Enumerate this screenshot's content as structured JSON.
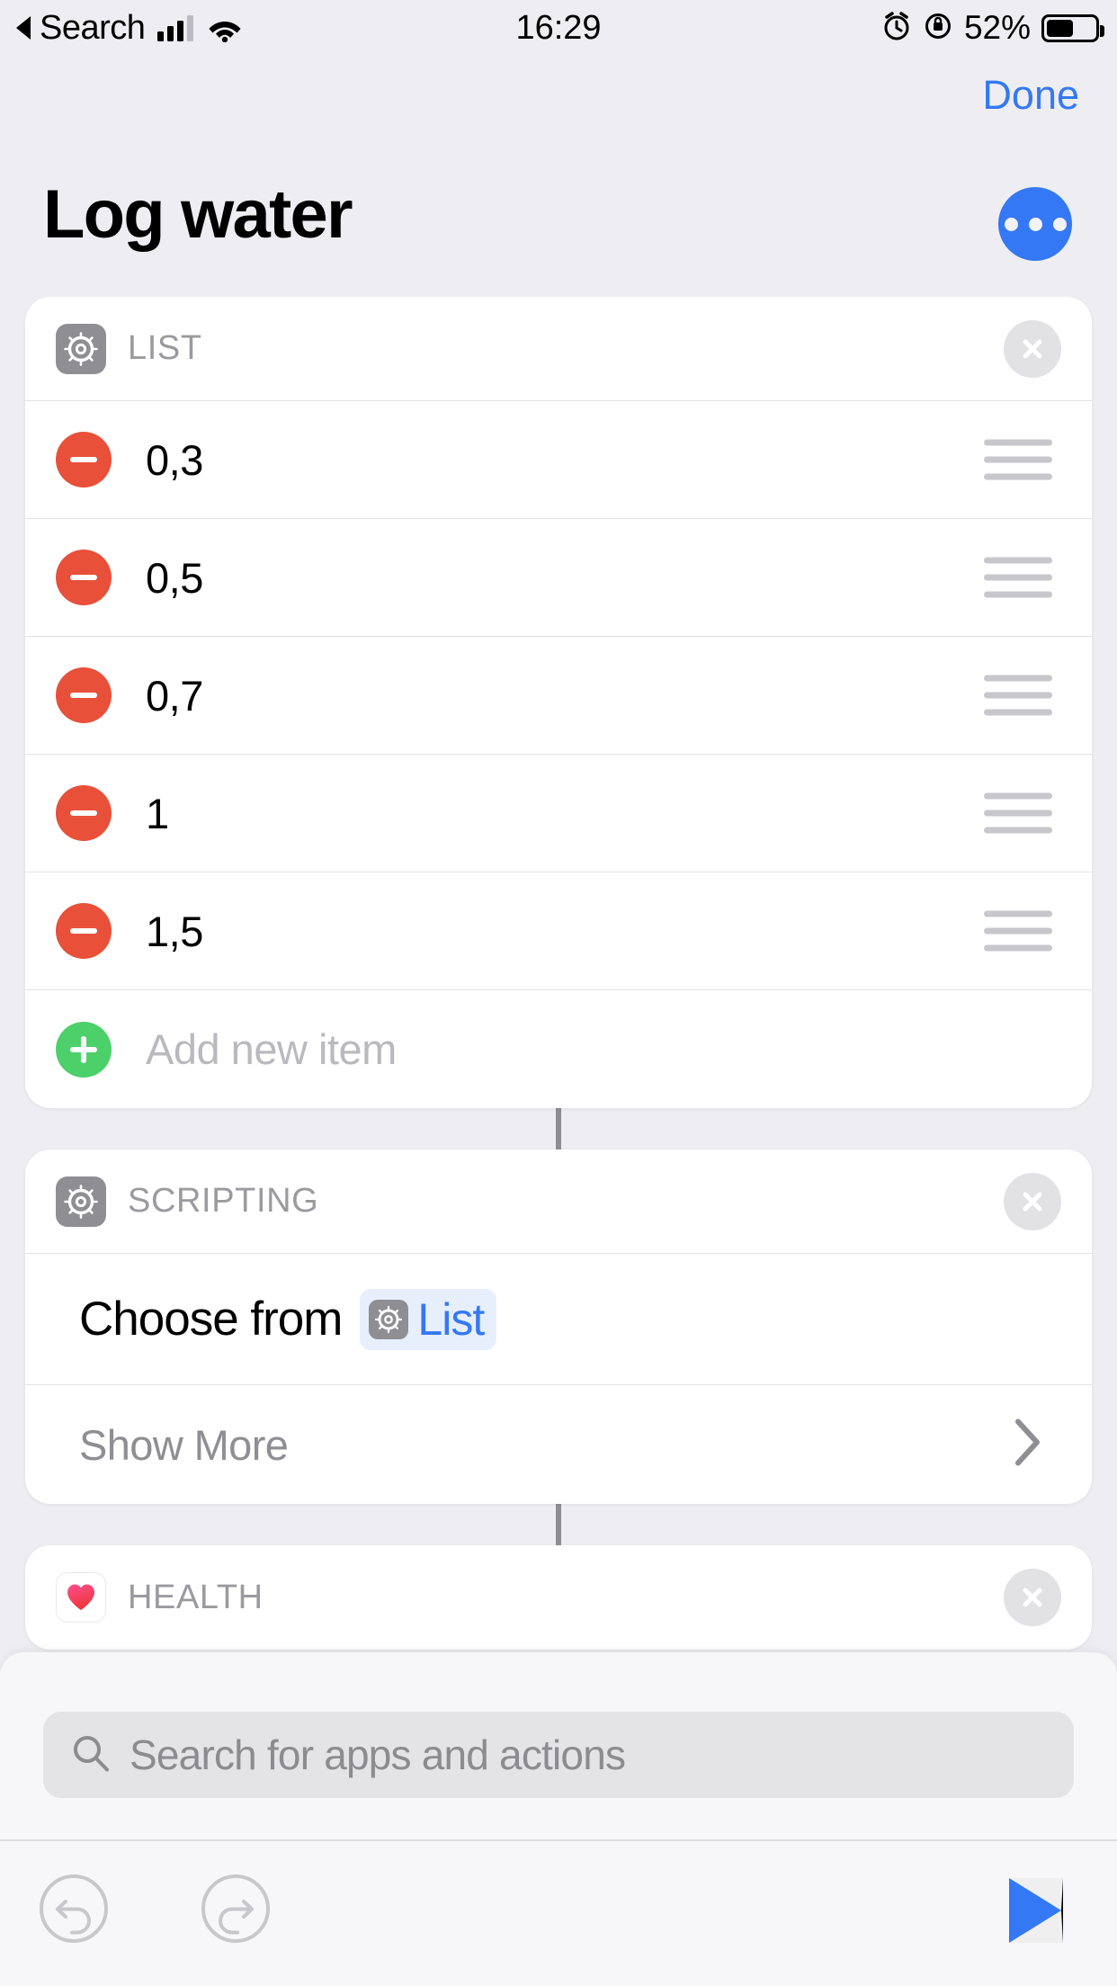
{
  "status_bar": {
    "back_label": "Search",
    "time": "16:29",
    "battery_percent": "52%",
    "icons": [
      "back-triangle-icon",
      "cellular-signal-icon",
      "wifi-icon",
      "alarm-clock-icon",
      "rotation-lock-icon",
      "battery-icon"
    ]
  },
  "nav": {
    "done_label": "Done",
    "title": "Log water",
    "more_label": "•••"
  },
  "cards": [
    {
      "category": "LIST",
      "icon": "gear-icon",
      "close_label": "✕",
      "rows": [
        {
          "value": "0,3",
          "action": "remove"
        },
        {
          "value": "0,5",
          "action": "remove"
        },
        {
          "value": "0,7",
          "action": "remove"
        },
        {
          "value": "1",
          "action": "remove"
        },
        {
          "value": "1,5",
          "action": "remove"
        }
      ],
      "add_placeholder": "Add new item"
    },
    {
      "category": "SCRIPTING",
      "icon": "gear-icon",
      "close_label": "✕",
      "action_text": "Choose from",
      "token_label": "List",
      "token_icon": "gear-icon",
      "show_more_label": "Show More"
    },
    {
      "category": "HEALTH",
      "icon": "heart-icon",
      "close_label": "✕"
    }
  ],
  "sheet": {
    "search_placeholder": "Search for apps and actions",
    "search_value": ""
  },
  "toolbar": {
    "undo_label": "Undo",
    "redo_label": "Redo",
    "run_label": "Run"
  },
  "colors": {
    "accent_blue": "#3478f6",
    "remove_red": "#e8503a",
    "add_green": "#4cd06a",
    "category_gray": "#8e8e93",
    "background": "#eeeef2",
    "card": "#ffffff",
    "token_bg": "#e7effd",
    "heart_pink": "#f8416c"
  }
}
